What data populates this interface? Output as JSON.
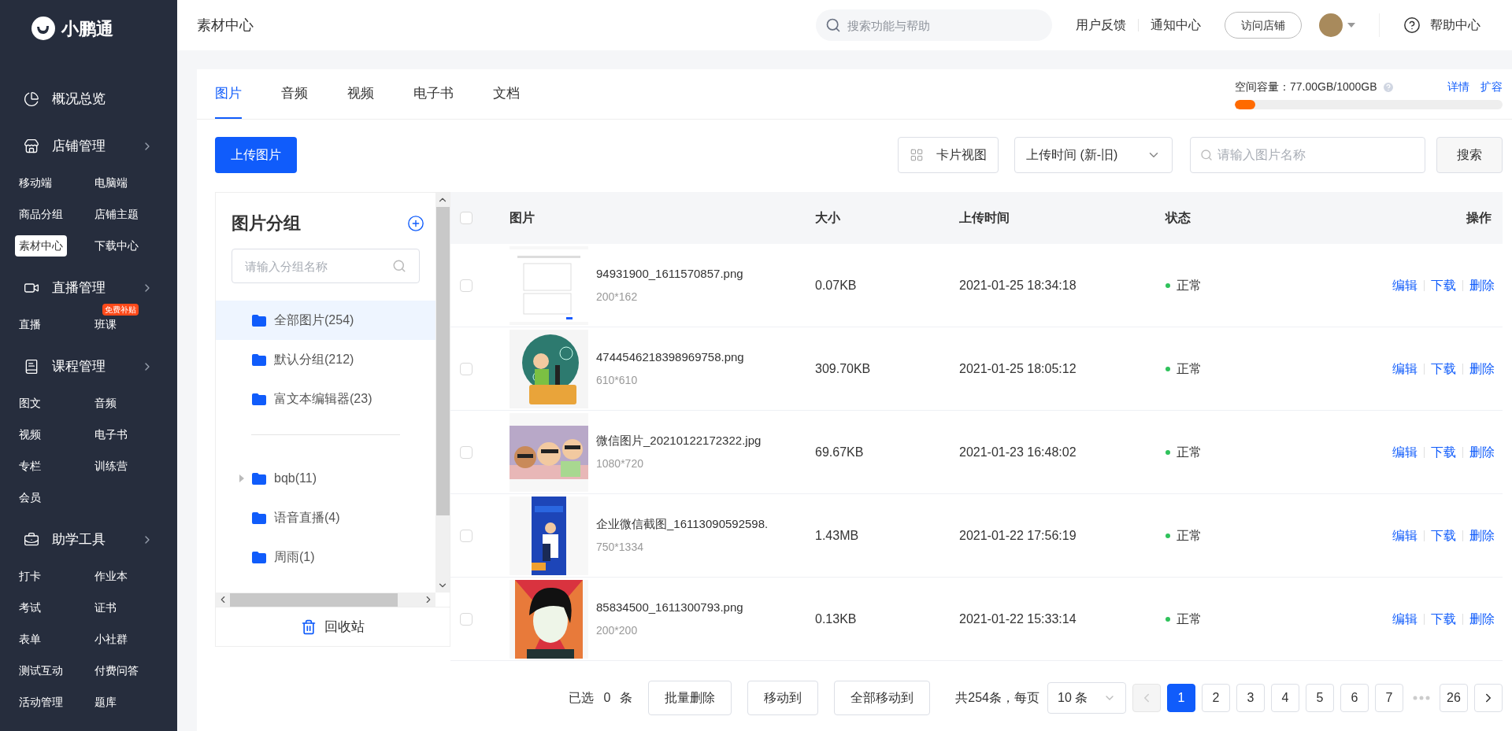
{
  "sidebar": {
    "logo": "小鹏通",
    "sections": [
      {
        "title": "概况总览",
        "kind": "link"
      },
      {
        "title": "店铺管理",
        "kind": "group",
        "items": [
          {
            "label": "移动端",
            "selected": false
          },
          {
            "label": "电脑端",
            "selected": false
          },
          {
            "label": "商品分组",
            "selected": false
          },
          {
            "label": "店铺主题",
            "selected": false
          },
          {
            "label": "素材中心",
            "selected": true
          },
          {
            "label": "下载中心",
            "selected": false
          }
        ]
      },
      {
        "title": "直播管理",
        "kind": "group",
        "items": [
          {
            "label": "直播",
            "selected": false
          },
          {
            "label": "班课",
            "selected": false,
            "badge": "免费补贴"
          }
        ]
      },
      {
        "title": "课程管理",
        "kind": "group",
        "items": [
          {
            "label": "图文",
            "selected": false
          },
          {
            "label": "音频",
            "selected": false
          },
          {
            "label": "视频",
            "selected": false
          },
          {
            "label": "电子书",
            "selected": false
          },
          {
            "label": "专栏",
            "selected": false
          },
          {
            "label": "训练营",
            "selected": false
          },
          {
            "label": "会员",
            "selected": false
          }
        ]
      },
      {
        "title": "助学工具",
        "kind": "group",
        "items": [
          {
            "label": "打卡",
            "selected": false
          },
          {
            "label": "作业本",
            "selected": false
          },
          {
            "label": "考试",
            "selected": false
          },
          {
            "label": "证书",
            "selected": false
          },
          {
            "label": "表单",
            "selected": false
          },
          {
            "label": "小社群",
            "selected": false
          },
          {
            "label": "测试互动",
            "selected": false
          },
          {
            "label": "付费问答",
            "selected": false
          },
          {
            "label": "活动管理",
            "selected": false
          },
          {
            "label": "题库",
            "selected": false
          }
        ]
      }
    ]
  },
  "header": {
    "title": "素材中心",
    "search": {
      "placeholder": "搜索功能与帮助"
    },
    "links": [
      "用户反馈",
      "通知中心"
    ],
    "visit_button": "访问店铺",
    "help": "帮助中心"
  },
  "tabs": [
    {
      "label": "图片",
      "selected": true
    },
    {
      "label": "音频",
      "selected": false
    },
    {
      "label": "视频",
      "selected": false
    },
    {
      "label": "电子书",
      "selected": false
    },
    {
      "label": "文档",
      "selected": false
    }
  ],
  "storage": {
    "label": "空间容量：77.00GB/1000GB",
    "level": 0.077,
    "links": [
      "详情",
      "扩容"
    ]
  },
  "toolbar": {
    "upload": "上传图片",
    "view": "卡片视图",
    "sort": "上传时间 (新-旧)",
    "search": {
      "placeholder": "请输入图片名称"
    },
    "search_button": "搜索"
  },
  "groups": {
    "title": "图片分组",
    "search": {
      "placeholder": "请输入分组名称"
    },
    "fixed": [
      {
        "label": "全部图片(254)",
        "selected": true
      },
      {
        "label": "默认分组(212)",
        "selected": false
      },
      {
        "label": "富文本编辑器(23)",
        "selected": false
      }
    ],
    "custom": [
      {
        "label": "bqb(11)",
        "selected": false,
        "expanded": false
      },
      {
        "label": "语音直播(4)",
        "selected": false
      },
      {
        "label": "周雨(1)",
        "selected": false
      }
    ],
    "recycle": "回收站"
  },
  "table": {
    "header_checked": false,
    "columns": [
      "图片",
      "大小",
      "上传时间",
      "状态",
      "操作"
    ],
    "rows": [
      {
        "checked": false,
        "name": "94931900_1611570857.png",
        "dims": "200*162",
        "size": "0.07KB",
        "time": "2021-01-25 18:34:18",
        "status": {
          "label": "正常",
          "color": "#2fc25b"
        },
        "actions": [
          "编辑",
          "下载",
          "删除"
        ]
      },
      {
        "checked": false,
        "name": "4744546218398969758.png",
        "dims": "610*610",
        "size": "309.70KB",
        "time": "2021-01-25 18:05:12",
        "status": {
          "label": "正常",
          "color": "#2fc25b"
        },
        "actions": [
          "编辑",
          "下载",
          "删除"
        ]
      },
      {
        "checked": false,
        "name": "微信图片_20210122172322.jpg",
        "dims": "1080*720",
        "size": "69.67KB",
        "time": "2021-01-23 16:48:02",
        "status": {
          "label": "正常",
          "color": "#2fc25b"
        },
        "actions": [
          "编辑",
          "下载",
          "删除"
        ]
      },
      {
        "checked": false,
        "name": "企业微信截图_16113090592598.",
        "dims": "750*1334",
        "size": "1.43MB",
        "time": "2021-01-22 17:56:19",
        "status": {
          "label": "正常",
          "color": "#2fc25b"
        },
        "actions": [
          "编辑",
          "下载",
          "删除"
        ]
      },
      {
        "checked": false,
        "name": "85834500_1611300793.png",
        "dims": "200*200",
        "size": "0.13KB",
        "time": "2021-01-22 15:33:14",
        "status": {
          "label": "正常",
          "color": "#2fc25b"
        },
        "actions": [
          "编辑",
          "下载",
          "删除"
        ]
      }
    ]
  },
  "footer": {
    "selected_label": "已选",
    "selected_count": "0",
    "selected_unit": "条",
    "buttons": [
      "批量删除",
      "移动到",
      "全部移动到"
    ],
    "total": "共254条，每页",
    "page_size": "10 条",
    "prev_disabled": true,
    "pages": [
      {
        "label": "1",
        "selected": true
      },
      {
        "label": "2",
        "selected": false
      },
      {
        "label": "3",
        "selected": false
      },
      {
        "label": "4",
        "selected": false
      },
      {
        "label": "5",
        "selected": false
      },
      {
        "label": "6",
        "selected": false
      },
      {
        "label": "7",
        "selected": false
      }
    ],
    "last_page": "26"
  }
}
